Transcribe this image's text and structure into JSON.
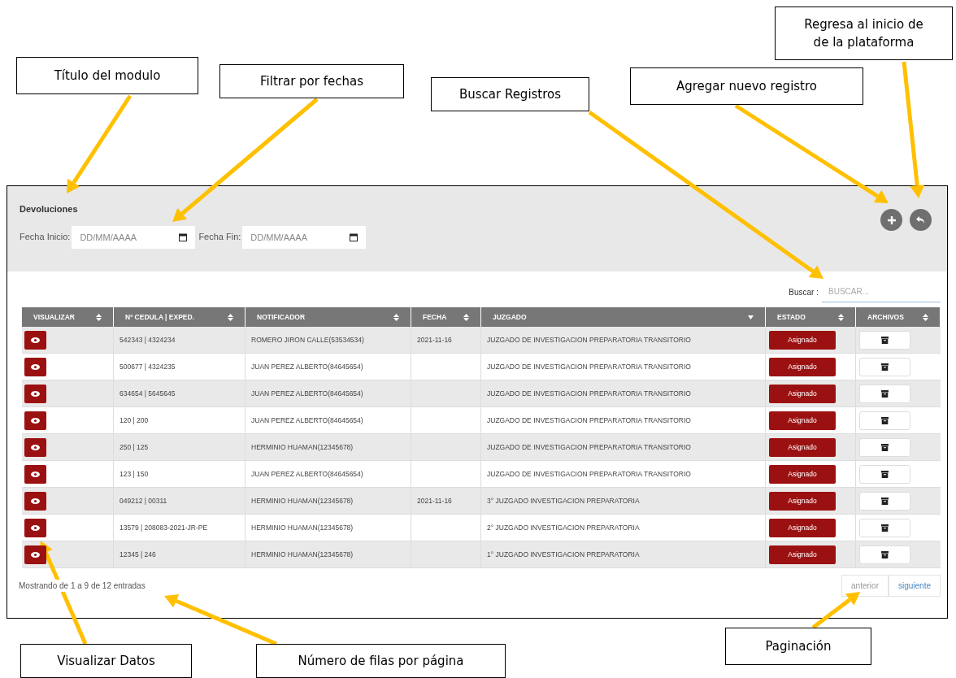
{
  "annotations": [
    {
      "lines": [
        "Título del modulo"
      ]
    },
    {
      "lines": [
        "Filtrar por fechas"
      ]
    },
    {
      "lines": [
        "Buscar Registros"
      ]
    },
    {
      "lines": [
        "Agregar nuevo registro"
      ]
    },
    {
      "lines": [
        "Regresa al inicio de",
        "de la plataforma"
      ]
    },
    {
      "lines": [
        "Visualizar Datos"
      ]
    },
    {
      "lines": [
        "Número de filas por página"
      ]
    },
    {
      "lines": [
        "Paginación"
      ]
    }
  ],
  "module": {
    "title": "Devoluciones",
    "filters": [
      {
        "label": "Fecha Inicio:",
        "placeholder": "DD/MM/AAAA"
      },
      {
        "label": "Fecha Fin:",
        "placeholder": "DD/MM/AAAA"
      }
    ],
    "search": {
      "label": "Buscar :",
      "placeholder": "BUSCAR..."
    },
    "table": {
      "columns": [
        {
          "label": "VISUALIZAR",
          "kind": "sortable"
        },
        {
          "label": "Nº CEDULA | EXPED.",
          "kind": "sortable"
        },
        {
          "label": "NOTIFICADOR",
          "kind": "sortable"
        },
        {
          "label": "FECHA",
          "kind": "sortable"
        },
        {
          "label": "JUZGADO",
          "kind": "sorted"
        },
        {
          "label": "ESTADO",
          "kind": "sortable"
        },
        {
          "label": "ARCHIVOS",
          "kind": "sortable"
        }
      ],
      "rows": [
        {
          "cedula": "542343 | 4324234",
          "notificador": "ROMERO JIRON CALLE(53534534)",
          "fecha": "2021-11-16",
          "juzgado": "JUZGADO DE INVESTIGACION PREPARATORIA TRANSITORIO",
          "estado": "Asignado"
        },
        {
          "cedula": "500677 | 4324235",
          "notificador": "JUAN PEREZ ALBERTO(84645654)",
          "juzgado": "JUZGADO DE INVESTIGACION PREPARATORIA TRANSITORIO",
          "estado": "Asignado"
        },
        {
          "cedula": "634654 | 5645645",
          "notificador": "JUAN PEREZ ALBERTO(84645654)",
          "juzgado": "JUZGADO DE INVESTIGACION PREPARATORIA TRANSITORIO",
          "estado": "Asignado"
        },
        {
          "cedula": "120 | 200",
          "notificador": "JUAN PEREZ ALBERTO(84645654)",
          "juzgado": "JUZGADO DE INVESTIGACION PREPARATORIA TRANSITORIO",
          "estado": "Asignado"
        },
        {
          "cedula": "250 | 125",
          "notificador": "HERMINIO HUAMAN(12345678)",
          "juzgado": "JUZGADO DE INVESTIGACION PREPARATORIA TRANSITORIO",
          "estado": "Asignado"
        },
        {
          "cedula": "123 | 150",
          "notificador": "JUAN PEREZ ALBERTO(84645654)",
          "juzgado": "JUZGADO DE INVESTIGACION PREPARATORIA TRANSITORIO",
          "estado": "Asignado"
        },
        {
          "cedula": "049212 | 00311",
          "notificador": "HERMINIO HUAMAN(12345678)",
          "fecha": "2021-11-16",
          "juzgado": "3° JUZGADO INVESTIGACION PREPARATORIA",
          "estado": "Asignado"
        },
        {
          "cedula": "13579 | 208083-2021-JR-PE",
          "notificador": "HERMINIO HUAMAN(12345678)",
          "juzgado": "2° JUZGADO INVESTIGACION PREPARATORIA",
          "estado": "Asignado"
        },
        {
          "cedula": "12345 | 246",
          "notificador": "HERMINIO HUAMAN(12345678)",
          "juzgado": "1° JUZGADO INVESTIGACION PREPARATORIA",
          "estado": "Asignado"
        }
      ]
    },
    "info": "Mostrando de 1 a 9 de 12 entradas",
    "pagination": [
      {
        "label": "anterior",
        "disabled": true
      },
      {
        "label": "siguiente",
        "disabled": false
      }
    ]
  }
}
